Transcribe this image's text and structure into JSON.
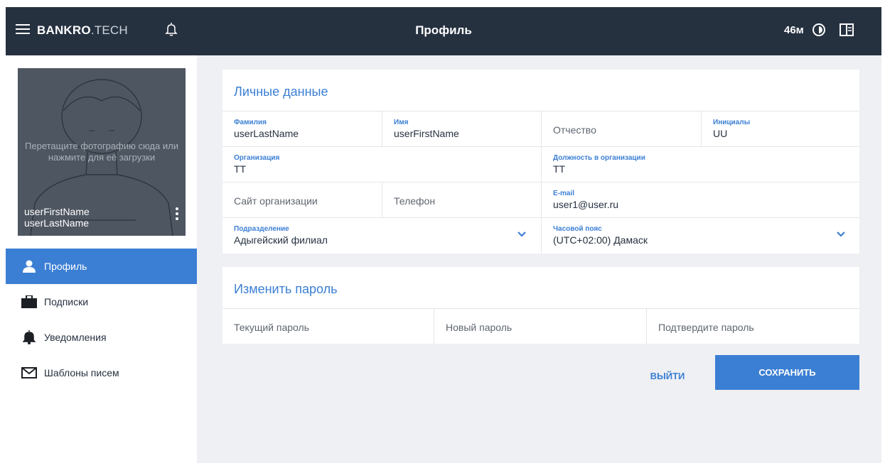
{
  "header": {
    "logo_bold": "BANKRO",
    "logo_rest": ".TECH",
    "title": "Профиль",
    "timer": "46м",
    "icons": [
      "menu-icon",
      "bell-icon",
      "theme-icon",
      "layout-icon"
    ]
  },
  "sidebar": {
    "photo_hint": "Перетащите фотографию сюда или нажмите для её загрузки",
    "first_name": "userFirstName",
    "last_name": "userLastName",
    "items": [
      {
        "label": "Профиль",
        "icon": "user-icon",
        "active": true
      },
      {
        "label": "Подписки",
        "icon": "briefcase-icon",
        "active": false
      },
      {
        "label": "Уведомления",
        "icon": "bell-icon",
        "active": false
      },
      {
        "label": "Шаблоны писем",
        "icon": "envelope-icon",
        "active": false
      }
    ]
  },
  "personal": {
    "title": "Личные данные",
    "last_name": {
      "label": "Фамилия",
      "value": "userLastName"
    },
    "first_name": {
      "label": "Имя",
      "value": "userFirstName"
    },
    "middle_name": {
      "placeholder": "Отчество"
    },
    "initials": {
      "label": "Инициалы",
      "value": "UU"
    },
    "organization": {
      "label": "Организация",
      "value": "ТТ"
    },
    "position": {
      "label": "Должность в организации",
      "value": "ТТ"
    },
    "site": {
      "placeholder": "Сайт организации"
    },
    "phone": {
      "placeholder": "Телефон"
    },
    "email": {
      "label": "E-mail",
      "value": "user1@user.ru"
    },
    "department": {
      "label": "Подразделение",
      "value": "Адыгейский филиал"
    },
    "timezone": {
      "label": "Часовой пояс",
      "value": "(UTC+02:00) Дамаск"
    }
  },
  "password": {
    "title": "Изменить пароль",
    "current": "Текущий пароль",
    "new": "Новый пароль",
    "confirm": "Подтвердите пароль"
  },
  "actions": {
    "logout": "ВЫЙТИ",
    "save": "СОХРАНИТЬ"
  },
  "colors": {
    "header_bg": "#263140",
    "accent": "#3b7fd4",
    "page_bg": "#eef0f3",
    "photo_bg": "#4e5661"
  }
}
